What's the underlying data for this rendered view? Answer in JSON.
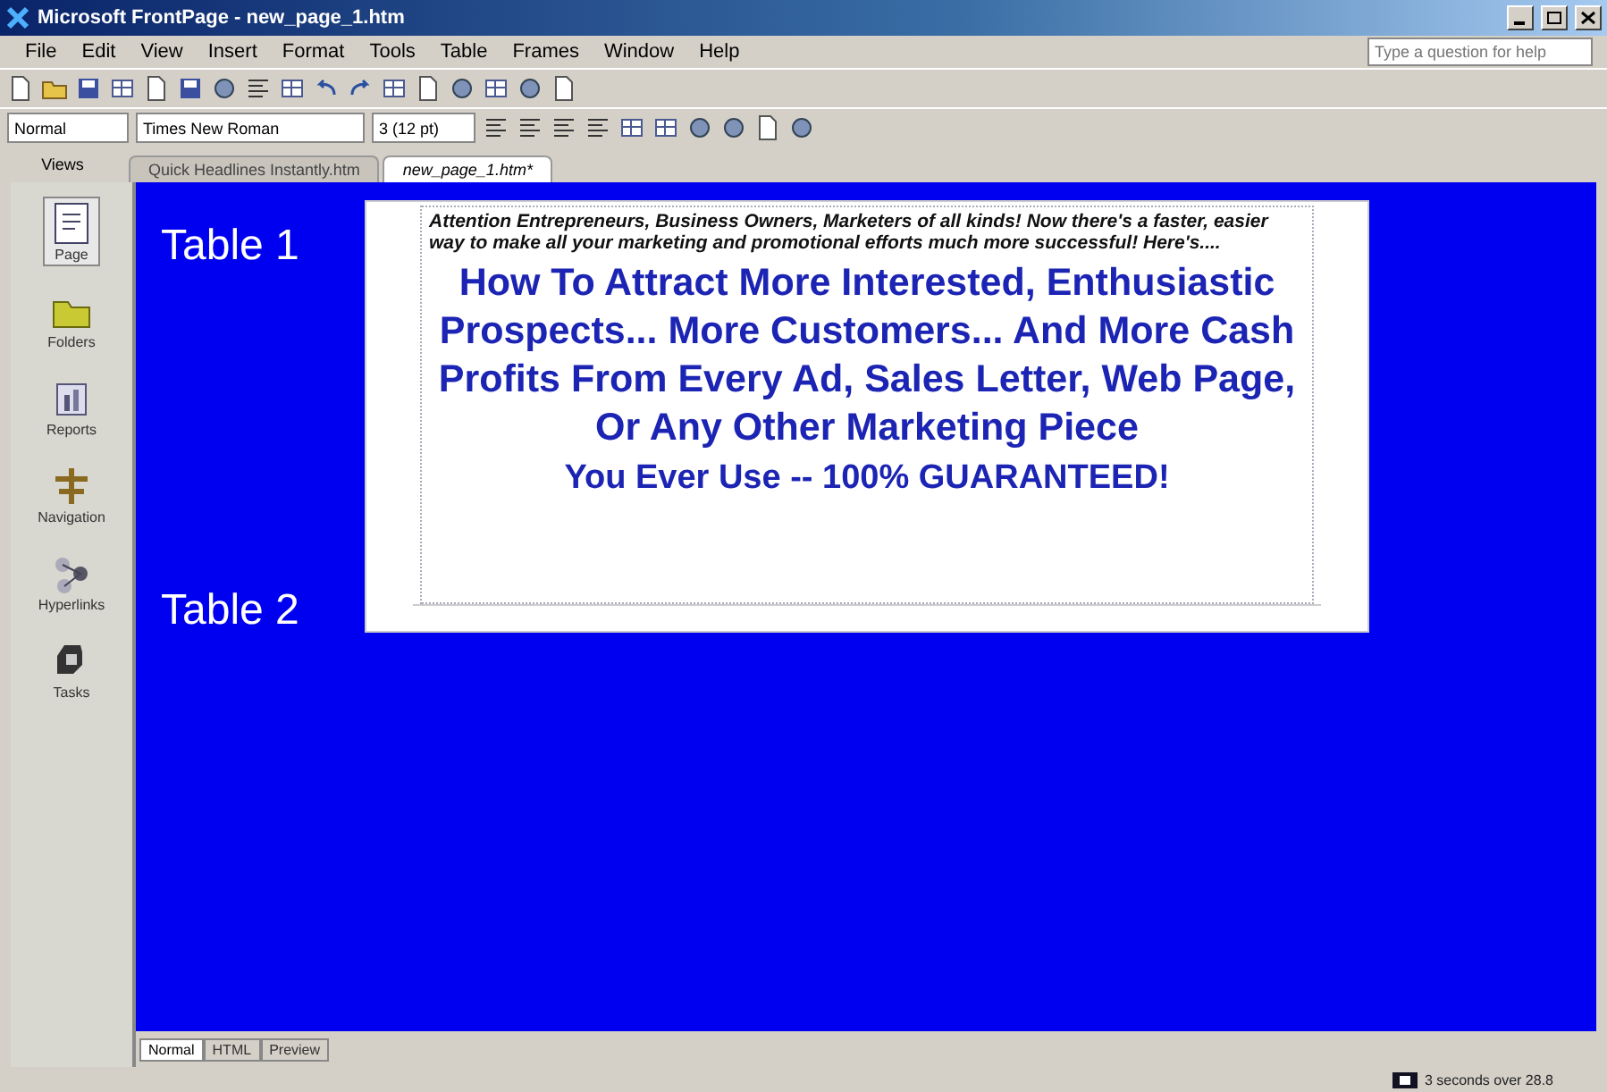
{
  "window": {
    "title": "Microsoft FrontPage - new_page_1.htm"
  },
  "menu": [
    "File",
    "Edit",
    "View",
    "Insert",
    "Format",
    "Tools",
    "Table",
    "Frames",
    "Window",
    "Help"
  ],
  "help_field": {
    "placeholder": "Type a question for help"
  },
  "format_bar": {
    "style": "Normal",
    "font": "Times New Roman",
    "size": "3 (12 pt)"
  },
  "views_label": "Views",
  "doc_tabs": [
    {
      "label": "Quick Headlines Instantly.htm",
      "selected": false
    },
    {
      "label": "new_page_1.htm*",
      "selected": true
    }
  ],
  "views": [
    {
      "label": "Page",
      "kind": "page",
      "selected": true
    },
    {
      "label": "Folders",
      "kind": "folders",
      "selected": false
    },
    {
      "label": "Reports",
      "kind": "reports",
      "selected": false
    },
    {
      "label": "Navigation",
      "kind": "navigation",
      "selected": false
    },
    {
      "label": "Hyperlinks",
      "kind": "hyperlinks",
      "selected": false
    },
    {
      "label": "Tasks",
      "kind": "tasks",
      "selected": false
    }
  ],
  "canvas": {
    "labels": [
      "Table 1",
      "Table 2"
    ],
    "intro": "Attention Entrepreneurs, Business Owners, Marketers of all kinds! Now there's a faster, easier way to make all your marketing and promotional efforts much more successful! Here's....",
    "headline": "How To Attract More Interested, Enthusiastic Prospects... More Customers... And More Cash Profits From Every Ad, Sales Letter, Web Page, Or Any Other Marketing Piece",
    "guarantee": "You Ever Use -- 100% GUARANTEED!"
  },
  "mode_tabs": [
    {
      "label": "Normal",
      "selected": true
    },
    {
      "label": "HTML",
      "selected": false
    },
    {
      "label": "Preview",
      "selected": false
    }
  ],
  "status_bar": {
    "download_time": "3 seconds over 28.8"
  }
}
